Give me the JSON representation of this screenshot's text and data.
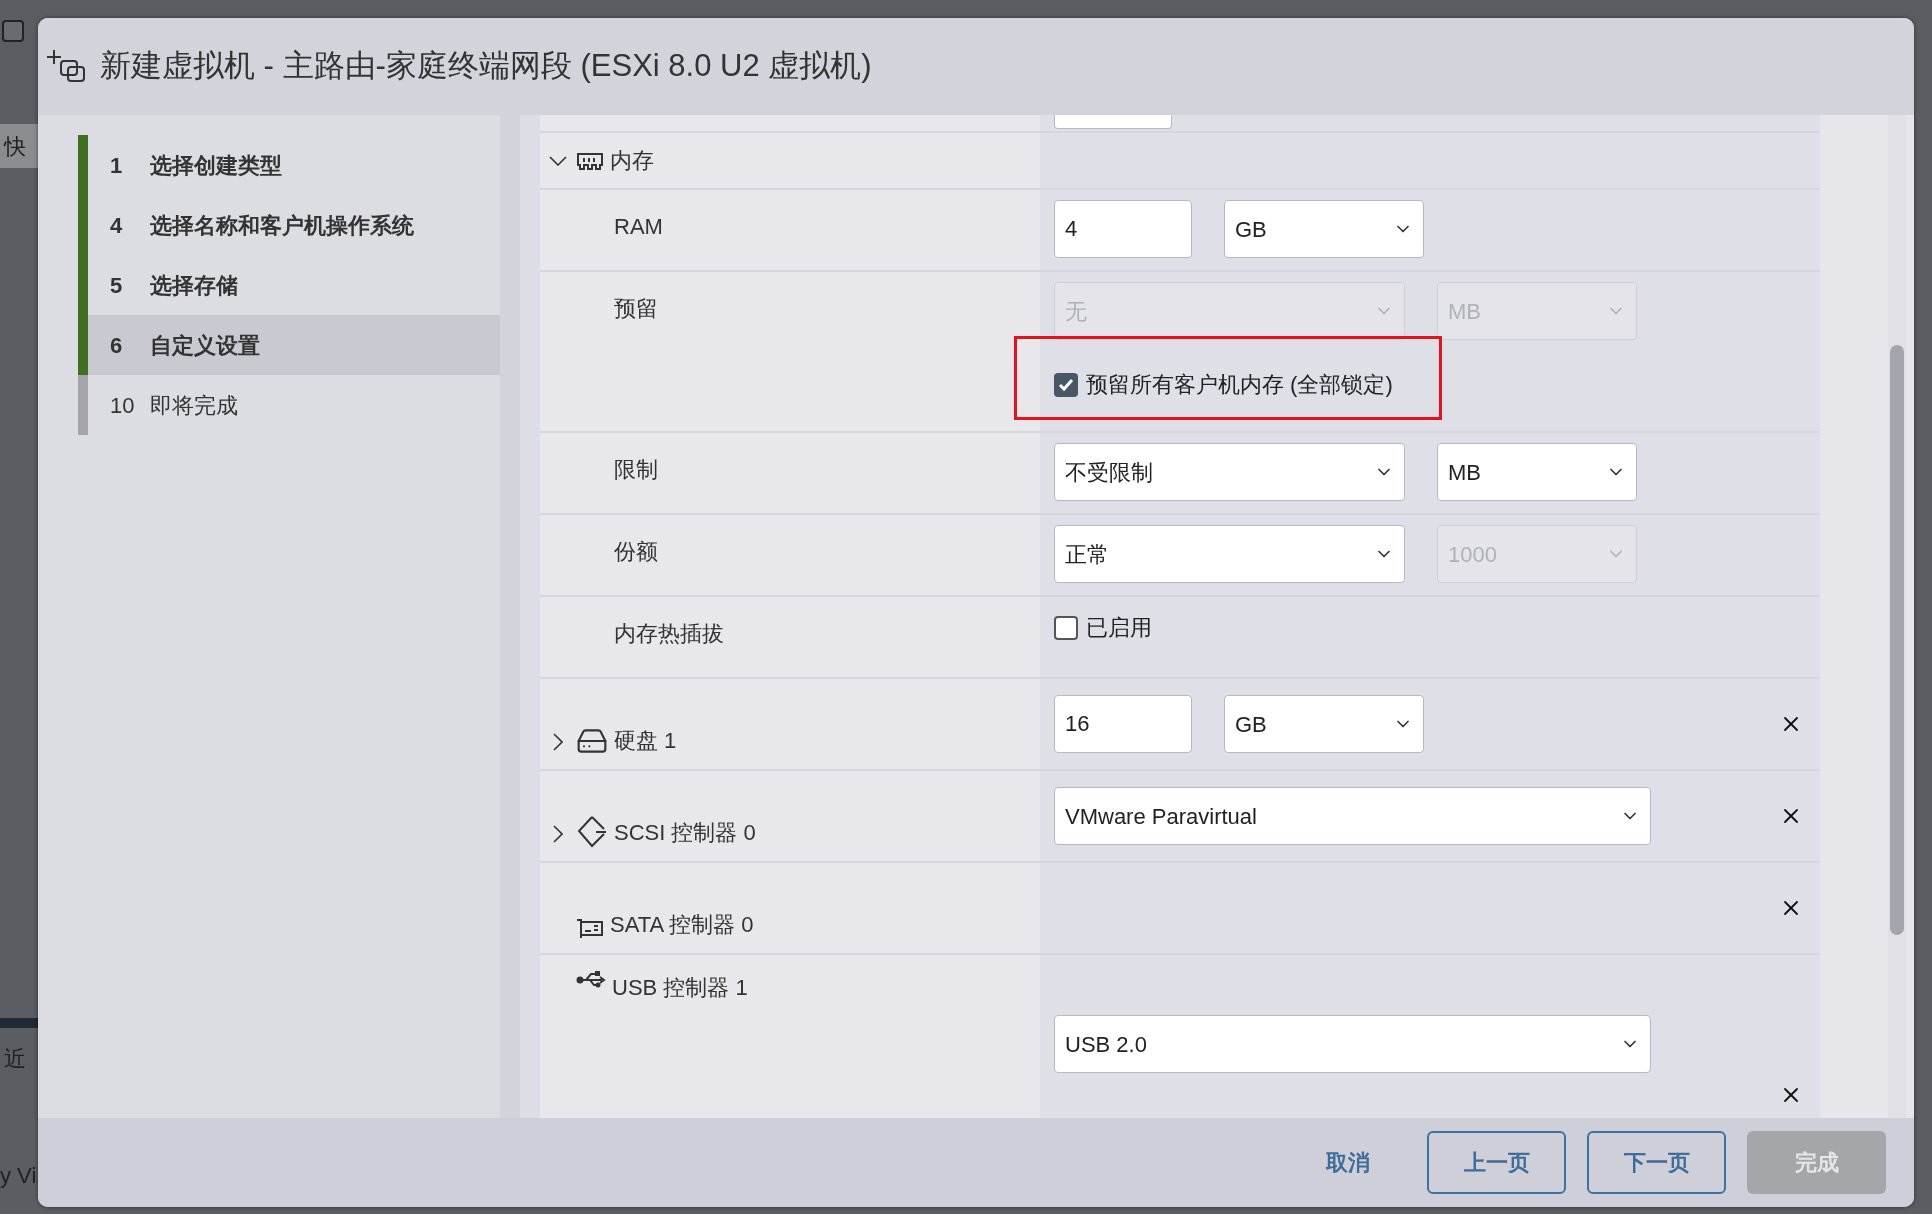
{
  "background": {
    "checkbox_checked": false,
    "button": "快",
    "texts": [
      "近",
      "y Vi"
    ]
  },
  "window": {
    "title": "新建虚拟机 - 主路由-家庭终端网段 (ESXi 8.0 U2 虚拟机)"
  },
  "steps": [
    {
      "number": "1",
      "label": "选择创建类型",
      "completed": true,
      "selected": false
    },
    {
      "number": "4",
      "label": "选择名称和客户机操作系统",
      "completed": true,
      "selected": false
    },
    {
      "number": "5",
      "label": "选择存储",
      "completed": true,
      "selected": false
    },
    {
      "number": "6",
      "label": "自定义设置",
      "completed": true,
      "selected": true
    },
    {
      "number": "10",
      "label": "即将完成",
      "completed": false,
      "selected": false
    }
  ],
  "rows": [
    {
      "kind": "section",
      "label": "内存",
      "expanded": true
    },
    {
      "kind": "setting",
      "label": "RAM",
      "controls": [
        {
          "kind": "input",
          "value": "4"
        },
        {
          "kind": "select",
          "value": "GB",
          "disabled": false
        }
      ]
    },
    {
      "kind": "setting",
      "label": "预留",
      "controls": [
        {
          "kind": "select",
          "value": "无",
          "disabled": true
        },
        {
          "kind": "select",
          "value": "MB",
          "disabled": true
        },
        {
          "kind": "checkbox",
          "label": "预留所有客户机内存 (全部锁定)",
          "checked": true,
          "highlighted": true
        }
      ]
    },
    {
      "kind": "setting",
      "label": "限制",
      "controls": [
        {
          "kind": "select",
          "value": "不受限制",
          "disabled": false
        },
        {
          "kind": "select",
          "value": "MB",
          "disabled": false
        }
      ]
    },
    {
      "kind": "setting",
      "label": "份额",
      "controls": [
        {
          "kind": "select",
          "value": "正常",
          "disabled": false
        },
        {
          "kind": "select",
          "value": "1000",
          "disabled": true
        }
      ]
    },
    {
      "kind": "setting",
      "label": "内存热插拔",
      "controls": [
        {
          "kind": "checkbox",
          "label": "已启用",
          "checked": false,
          "highlighted": false
        }
      ]
    },
    {
      "kind": "device",
      "label": "硬盘 1",
      "expanded": false,
      "controls": [
        {
          "kind": "input",
          "value": "16"
        },
        {
          "kind": "select",
          "value": "GB",
          "disabled": false
        }
      ]
    },
    {
      "kind": "device",
      "label": "SCSI 控制器 0",
      "expanded": false,
      "controls": [
        {
          "kind": "select",
          "value": "VMware Paravirtual",
          "disabled": false
        }
      ]
    },
    {
      "kind": "device",
      "label": "SATA 控制器 0"
    },
    {
      "kind": "device",
      "label": "USB 控制器 1",
      "controls": [
        {
          "kind": "select",
          "value": "USB 2.0",
          "disabled": false
        }
      ]
    }
  ],
  "footer": {
    "cancel": "取消",
    "buttons": [
      {
        "label": "上一页",
        "disabled": false
      },
      {
        "label": "下一页",
        "disabled": false
      },
      {
        "label": "完成",
        "disabled": true
      }
    ]
  }
}
